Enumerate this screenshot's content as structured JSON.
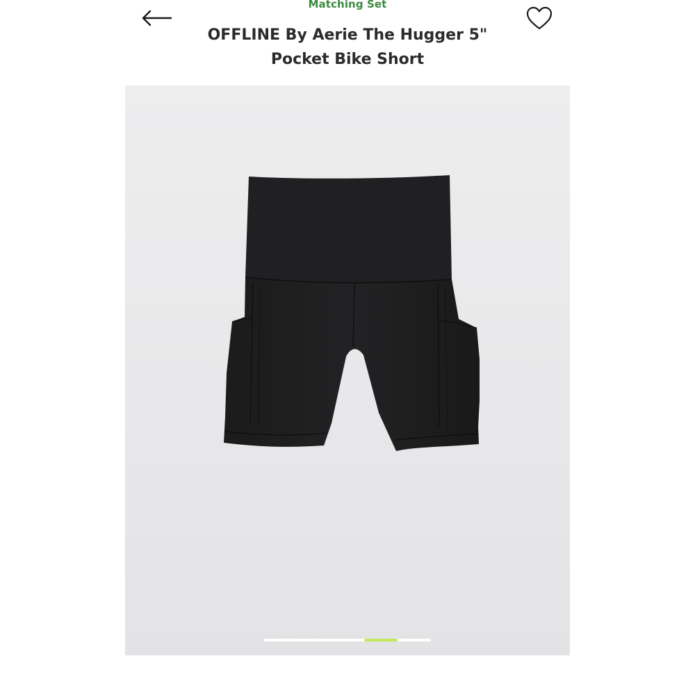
{
  "header": {
    "eyebrow": "Matching Set",
    "title": "OFFLINE By Aerie The Hugger 5\" Pocket Bike Short",
    "back_icon": "arrow-left-icon",
    "favorite_icon": "heart-outline-icon"
  },
  "gallery": {
    "page_count": 5,
    "active_page": 4,
    "indicator_color": "#c6e95a"
  },
  "colors": {
    "eyebrow": "#3b8a3e",
    "title": "#2b2b2b",
    "image_background": "#ebebec"
  }
}
